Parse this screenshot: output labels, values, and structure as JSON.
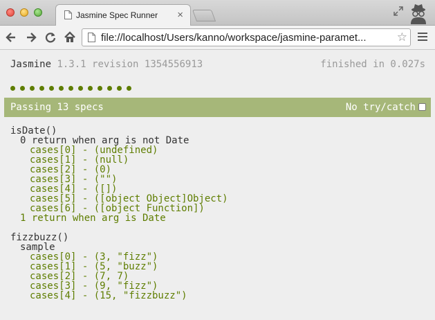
{
  "browser": {
    "tab_title": "Jasmine Spec Runner",
    "tab_close": "×",
    "url": "file://localhost/Users/kanno/workspace/jasmine-paramet..."
  },
  "jasmine": {
    "name": "Jasmine",
    "version": "1.3.1 revision 1354556913",
    "duration": "finished in 0.027s",
    "passing": "Passing 13 specs",
    "no_try_catch": "No try/catch",
    "no_try_catch_checked": false,
    "dot_count": 13,
    "dot_color": "#5e7d00",
    "bar_color": "#a6b779"
  },
  "results": [
    {
      "text": "isDate()",
      "kind": "suite",
      "indent": 0
    },
    {
      "text": "0 return when arg is not Date",
      "kind": "suite",
      "indent": 1
    },
    {
      "text": "cases[0] - (undefined)",
      "kind": "spec",
      "indent": 2
    },
    {
      "text": "cases[1] - (null)",
      "kind": "spec",
      "indent": 2
    },
    {
      "text": "cases[2] - (0)",
      "kind": "spec",
      "indent": 2
    },
    {
      "text": "cases[3] - (\"\")",
      "kind": "spec",
      "indent": 2
    },
    {
      "text": "cases[4] - ([])",
      "kind": "spec",
      "indent": 2
    },
    {
      "text": "cases[5] - ([object Object]Object)",
      "kind": "spec",
      "indent": 2
    },
    {
      "text": "cases[6] - ([object Function])",
      "kind": "spec",
      "indent": 2
    },
    {
      "text": "1 return when arg is Date",
      "kind": "spec",
      "indent": 1
    },
    {
      "text": "",
      "kind": "gap",
      "indent": 0
    },
    {
      "text": "fizzbuzz()",
      "kind": "suite",
      "indent": 0
    },
    {
      "text": "sample",
      "kind": "suite",
      "indent": 1
    },
    {
      "text": "cases[0] - (3, \"fizz\")",
      "kind": "spec",
      "indent": 2
    },
    {
      "text": "cases[1] - (5, \"buzz\")",
      "kind": "spec",
      "indent": 2
    },
    {
      "text": "cases[2] - (7, 7)",
      "kind": "spec",
      "indent": 2
    },
    {
      "text": "cases[3] - (9, \"fizz\")",
      "kind": "spec",
      "indent": 2
    },
    {
      "text": "cases[4] - (15, \"fizzbuzz\")",
      "kind": "spec",
      "indent": 2
    }
  ]
}
